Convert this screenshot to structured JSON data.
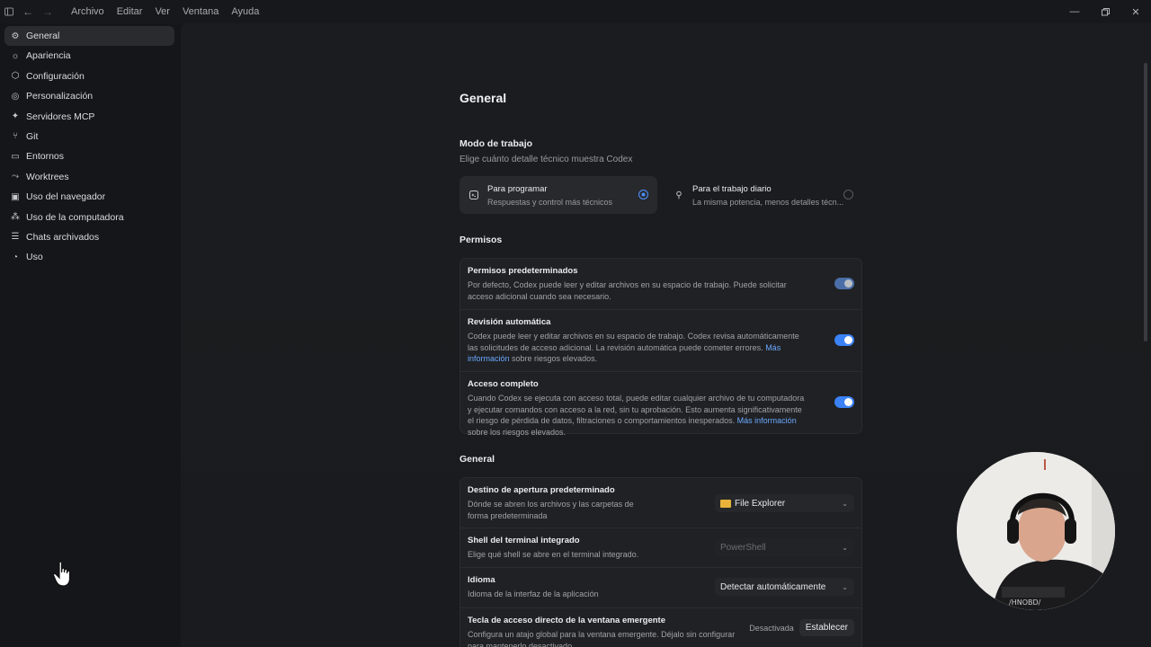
{
  "titlebar": {
    "menu": [
      "Archivo",
      "Editar",
      "Ver",
      "Ventana",
      "Ayuda"
    ]
  },
  "sidebar": {
    "items": [
      {
        "label": "General",
        "icon": "gear-icon",
        "active": true
      },
      {
        "label": "Apariencia",
        "icon": "sun-icon"
      },
      {
        "label": "Configuración",
        "icon": "settings-icon"
      },
      {
        "label": "Personalización",
        "icon": "personalize-icon"
      },
      {
        "label": "Servidores MCP",
        "icon": "mcp-icon"
      },
      {
        "label": "Git",
        "icon": "git-branch-icon"
      },
      {
        "label": "Entornos",
        "icon": "environment-icon"
      },
      {
        "label": "Worktrees",
        "icon": "worktree-icon"
      },
      {
        "label": "Uso del navegador",
        "icon": "browser-icon"
      },
      {
        "label": "Uso de la computadora",
        "icon": "computer-icon"
      },
      {
        "label": "Chats archivados",
        "icon": "archive-icon"
      },
      {
        "label": "Uso",
        "icon": "gauge-icon"
      }
    ]
  },
  "main": {
    "title": "General",
    "work_mode": {
      "title": "Modo de trabajo",
      "subtitle": "Elige cuánto detalle técnico muestra Codex",
      "options": [
        {
          "title": "Para programar",
          "desc": "Respuestas y control más técnicos",
          "selected": true
        },
        {
          "title": "Para el trabajo diario",
          "desc": "La misma potencia, menos detalles técn...",
          "selected": false
        }
      ]
    },
    "permissions": {
      "title": "Permisos",
      "rows": [
        {
          "title": "Permisos predeterminados",
          "desc": "Por defecto, Codex puede leer y editar archivos en su espacio de trabajo. Puede solicitar acceso adicional cuando sea necesario."
        },
        {
          "title": "Revisión automática",
          "desc_before": "Codex puede leer y editar archivos en su espacio de trabajo. Codex revisa automáticamente las solicitudes de acceso adicional. La revisión automática puede cometer errores. ",
          "link": "Más información",
          "desc_after": " sobre riesgos elevados."
        },
        {
          "title": "Acceso completo",
          "desc_before": "Cuando Codex se ejecuta con acceso total, puede editar cualquier archivo de tu computadora y ejecutar comandos con acceso a la red, sin tu aprobación. Esto aumenta significativamente el riesgo de pérdida de datos, filtraciones o comportamientos inesperados. ",
          "link": "Más información",
          "desc_after": " sobre los riesgos elevados."
        }
      ]
    },
    "general": {
      "title": "General",
      "rows": [
        {
          "title": "Destino de apertura predeterminado",
          "desc": "Dónde se abren los archivos y las carpetas de forma predeterminada",
          "value": "File Explorer"
        },
        {
          "title": "Shell del terminal integrado",
          "desc": "Elige qué shell se abre en el terminal integrado.",
          "value": "PowerShell"
        },
        {
          "title": "Idioma",
          "desc": "Idioma de la interfaz de la aplicación",
          "value": "Detectar automáticamente"
        },
        {
          "title": "Tecla de acceso directo de la ventana emergente",
          "desc": "Configura un atajo global para la ventana emergente. Déjalo sin configurar para mantenerlo desactivado.",
          "status": "Desactivada",
          "button": "Establecer"
        }
      ]
    }
  }
}
